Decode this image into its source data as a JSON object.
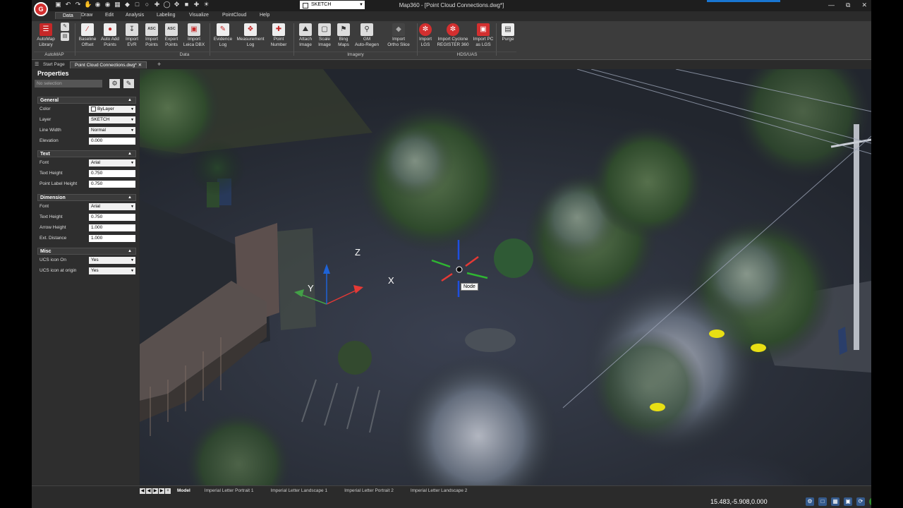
{
  "window": {
    "title": "Map360 - [Point Cloud Connections.dwg*]",
    "logo_text": "G"
  },
  "qat": {
    "layer": "SKETCH"
  },
  "ribbon_tabs": [
    {
      "label": "Data",
      "active": true
    },
    {
      "label": "Draw"
    },
    {
      "label": "Edit"
    },
    {
      "label": "Analysis"
    },
    {
      "label": "Labeling"
    },
    {
      "label": "Visualize"
    },
    {
      "label": "PointCloud"
    },
    {
      "label": "Help"
    }
  ],
  "ribbon": {
    "buttons": [
      {
        "l1": "AutoMap",
        "l2": "Library",
        "icon": "automap-library-icon"
      },
      {
        "l1": "Baseline",
        "l2": "Offset",
        "icon": "baseline-offset-icon"
      },
      {
        "l1": "Auto Add",
        "l2": "Points",
        "icon": "auto-add-points-icon"
      },
      {
        "l1": "Import",
        "l2": "EVR",
        "icon": "import-evr-icon"
      },
      {
        "l1": "Import",
        "l2": "Points",
        "icon": "import-points-icon"
      },
      {
        "l1": "Export",
        "l2": "Points",
        "icon": "export-points-icon"
      },
      {
        "l1": "Import",
        "l2": "Leica DBX",
        "icon": "import-leica-dbx-icon"
      },
      {
        "l1": "Evidence",
        "l2": "Log",
        "icon": "evidence-log-icon"
      },
      {
        "l1": "Measurement",
        "l2": "Log",
        "icon": "measurement-log-icon"
      },
      {
        "l1": "Point",
        "l2": "Number",
        "icon": "point-number-icon"
      },
      {
        "l1": "Attach",
        "l2": "Image",
        "icon": "attach-image-icon"
      },
      {
        "l1": "Scale",
        "l2": "Image",
        "icon": "scale-image-icon"
      },
      {
        "l1": "Bing",
        "l2": "Maps",
        "icon": "bing-maps-icon"
      },
      {
        "l1": "GM",
        "l2": "Auto-Regen",
        "icon": "gm-auto-regen-icon"
      },
      {
        "l1": "Import",
        "l2": "Ortho Slice",
        "icon": "import-ortho-slice-icon"
      },
      {
        "l1": "Import",
        "l2": "LGS",
        "icon": "import-lgs-icon"
      },
      {
        "l1": "Import Cyclone",
        "l2": "REGISTER 360",
        "icon": "import-cyclone-icon"
      },
      {
        "l1": "Import PC",
        "l2": "as LGS",
        "icon": "import-pc-lgs-icon"
      },
      {
        "l1": "Purge",
        "l2": "",
        "icon": "purge-icon"
      }
    ],
    "groups": [
      "AutoMAP",
      "Data",
      "Imagery",
      "HDS/UAS"
    ],
    "asc_text": "ASC"
  },
  "doc_tabs": [
    {
      "label": "Start Page"
    },
    {
      "label": "Point Cloud Connections.dwg*",
      "active": true
    }
  ],
  "properties": {
    "title": "Properties",
    "selection": "No selection",
    "sections": [
      {
        "name": "General",
        "rows": [
          {
            "label": "Color",
            "value": "ByLayer"
          },
          {
            "label": "Layer",
            "value": "SKETCH"
          },
          {
            "label": "Line Width",
            "value": "Normal"
          },
          {
            "label": "Elevation",
            "value": "0.000"
          }
        ]
      },
      {
        "name": "Text",
        "rows": [
          {
            "label": "Font",
            "value": "Arial"
          },
          {
            "label": "Text Height",
            "value": "0.750"
          },
          {
            "label": "Point Label Height",
            "value": "0.750"
          }
        ]
      },
      {
        "name": "Dimension",
        "rows": [
          {
            "label": "Font",
            "value": "Arial"
          },
          {
            "label": "Text Height",
            "value": "0.750"
          },
          {
            "label": "Arrow Height",
            "value": "1.000"
          },
          {
            "label": "Ext. Distance",
            "value": "1.000"
          }
        ]
      },
      {
        "name": "Misc",
        "rows": [
          {
            "label": "UCS icon On",
            "value": "Yes"
          },
          {
            "label": "UCS icon at origin",
            "value": "Yes"
          }
        ]
      }
    ]
  },
  "viewport": {
    "ucs": {
      "x": "X",
      "y": "Y",
      "z": "Z"
    },
    "snap_tooltip": "Node"
  },
  "layout_tabs": [
    {
      "label": "Model",
      "active": true
    },
    {
      "label": "Imperial Letter Portrait 1"
    },
    {
      "label": "Imperial Letter Landscape 1"
    },
    {
      "label": "Imperial Letter Portrait 2"
    },
    {
      "label": "Imperial Letter Landscape 2"
    }
  ],
  "status": {
    "coords": "15.483,-5.908,0.000"
  },
  "colors": {
    "accent": "#d32f2f",
    "ucs_x": "#e53935",
    "ucs_y": "#43a047",
    "ucs_z": "#1e63d6"
  }
}
